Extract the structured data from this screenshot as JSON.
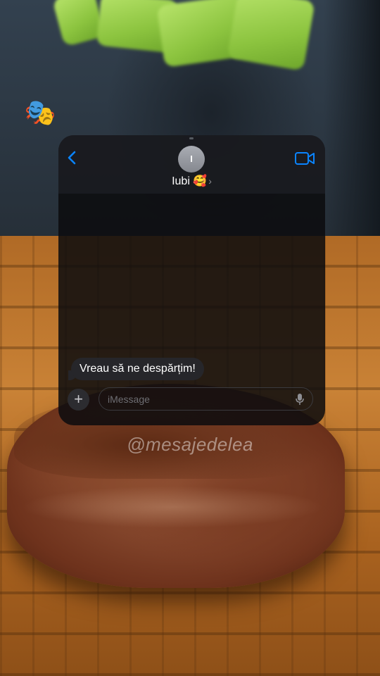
{
  "background": {
    "description_icon": "burger-patty-photo"
  },
  "sticker": {
    "emoji": "🎭",
    "icon": "theater-masks-icon"
  },
  "chat": {
    "avatar_initial": "I",
    "contact_name": "Iubi",
    "contact_emoji": "🥰",
    "contact_chevron": "›",
    "back_icon": "chevron-left-icon",
    "video_icon": "video-camera-icon",
    "accent_color": "#0a84ff",
    "messages": [
      {
        "text": "Vreau să ne despărțim!",
        "direction": "incoming"
      }
    ],
    "composer": {
      "plus_label": "+",
      "placeholder": "iMessage",
      "mic_icon": "microphone-icon"
    }
  },
  "watermark": "@mesajedelea"
}
